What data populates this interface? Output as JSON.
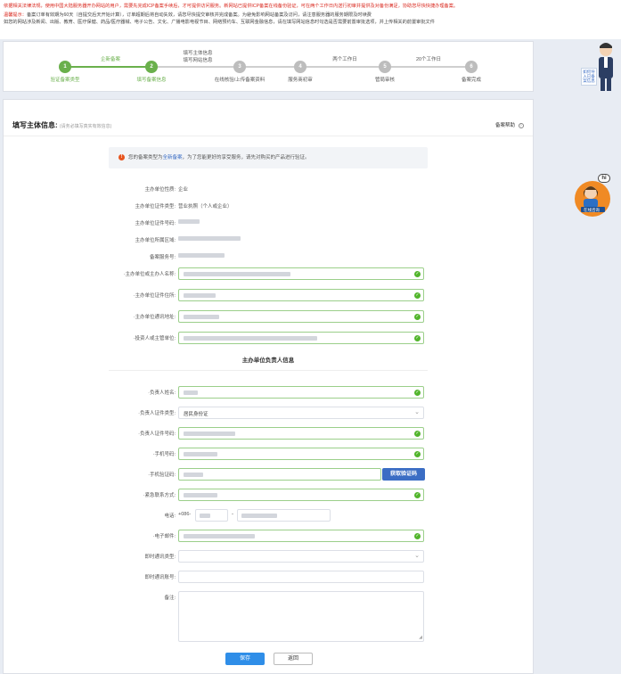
{
  "notice": {
    "red_text": "依据相关法律法规，使用中国大陆服务器开办网站的用户，需要先完成ICP备案手续后，才可提供访问服务。新网站已提供ICP备案在线备份验证，可在两个工作日内送行初审并提供及对备份满足，协助您尽快快捷办理备案。",
    "tip_label": "温馨提示：",
    "tip_text": "备案订单有效期为60天（自提交后天开始计算），订单超期后将自动失效，请您尽快提交审核并完成备案。为避免影响网站备案及访问，请注意服务器的服务期限及时续费",
    "line3": "如您的网站涉及新闻、出版、教育、医疗保健、药品/医疗器械、电子公告、文化、广播电影电视节目、网络预约车、互联网金融信息，请在填写网站信息时勾选是否需要前置审批选项，并上传相关的前置审批文件"
  },
  "steps": {
    "step1": {
      "num": "1",
      "label": "验证备案类型"
    },
    "step1_top": "企新备案",
    "step2": {
      "num": "2",
      "label": "填写备案信息"
    },
    "step2_top_a": "填写主体信息",
    "step2_top_b": "填写网站信息",
    "step3": {
      "num": "3",
      "label": "在线核验/上传备案资料"
    },
    "step4": {
      "num": "4",
      "label": "服务商初审"
    },
    "step4_top": "两个工作日",
    "step5": {
      "num": "5",
      "label": "管局审核"
    },
    "step5_top": "20个工作日",
    "step6": {
      "num": "6",
      "label": "备案完成"
    }
  },
  "side": {
    "help_badge": "如何导入已备案信息",
    "chat_hi": "hi",
    "chat_label": "在线咨询"
  },
  "form": {
    "title": "填写主体信息:",
    "title_sub": "(请务必填写真实有效信息)",
    "help_link": "备案帮助",
    "help_icon": "question-circle-icon",
    "alert_pre": "您的备案类型为",
    "alert_hl": "全新备案",
    "alert_post": "，为了您能更好的享受服务，请先对购买的产品进行验证。",
    "labels": {
      "nature": "主办单位性质:",
      "cert_type": "主办单位证件类型:",
      "cert_no": "主办单位证件号码:",
      "region": "主办单位所属区域:",
      "service_no": "备案服务号:",
      "org_name": "·主办单位或主办人名称:",
      "cert_addr": "·主办单位证件住所:",
      "comm_addr": "·主办单位通讯地址:",
      "investor": "·投资人或主管单位:",
      "section": "主办单位负责人信息",
      "leader_name": "·负责人姓名:",
      "leader_cert_type": "·负责人证件类型:",
      "leader_cert_no": "·负责人证件号码:",
      "mobile": "·手机号码:",
      "sms_code": "·手机验证码:",
      "emergency": "·紧急联系方式:",
      "phone": "电话:",
      "email": "·电子邮件:",
      "im_type": "即时通讯类型:",
      "im_account": "即时通讯账号:",
      "remark": "备注:"
    },
    "values": {
      "nature": "企业",
      "cert_type": "营业执照（个人或企业）",
      "leader_cert_type": "居民身份证",
      "phone_prefix": "+086-",
      "phone_sep": "-"
    },
    "buttons": {
      "get_code": "获取验证码",
      "save": "保存",
      "back": "返回"
    }
  }
}
